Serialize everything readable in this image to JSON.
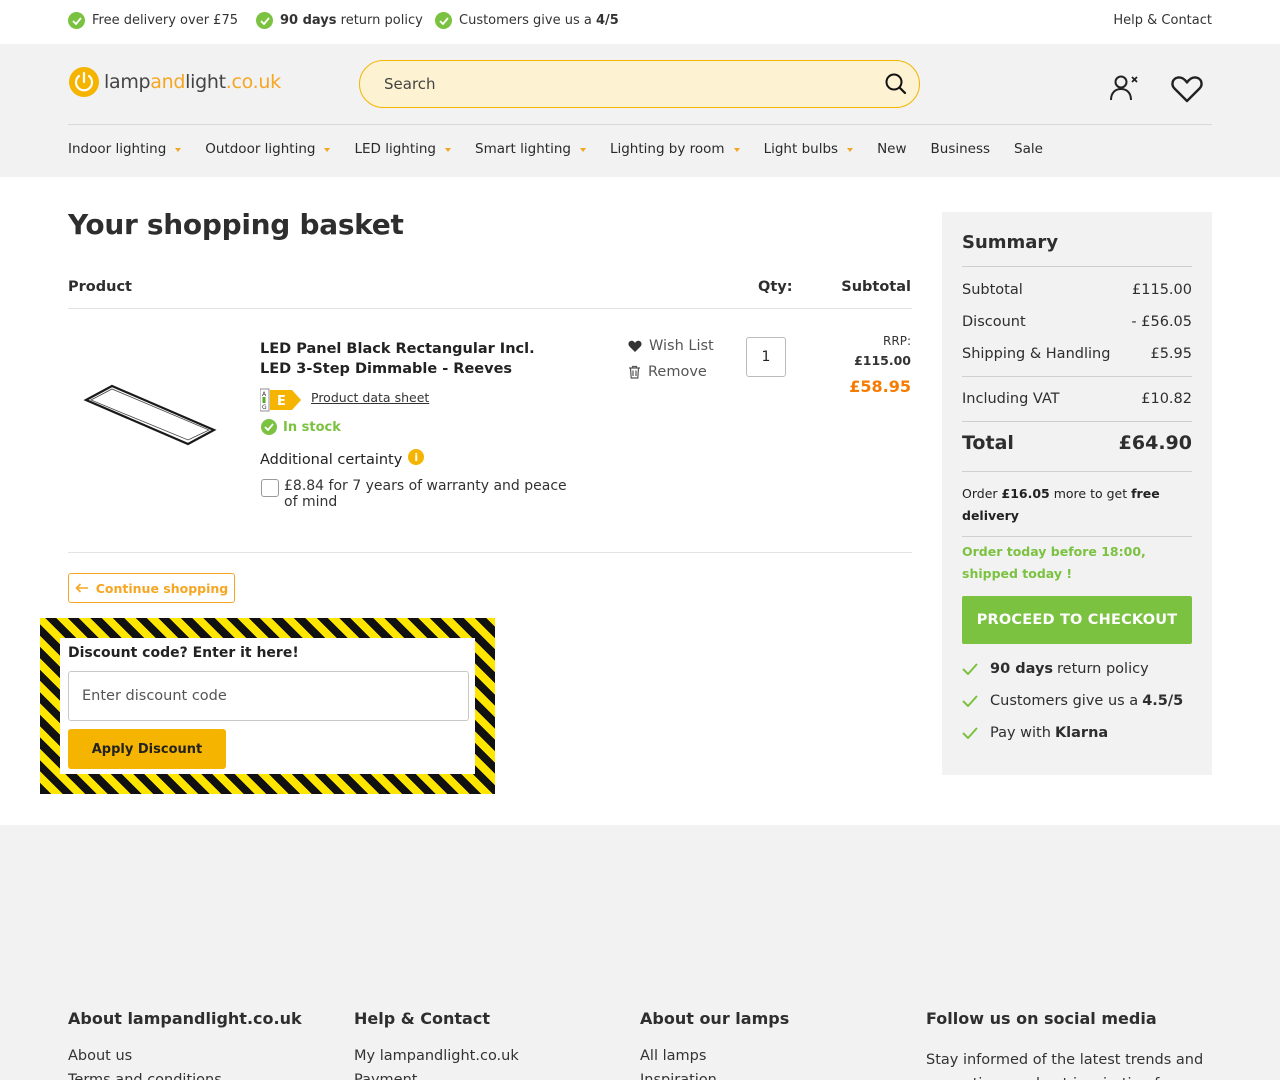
{
  "usp": {
    "delivery": "Free delivery over £75",
    "returns_bold": "90 days",
    "returns_rest": " return policy",
    "rating_text": "Customers give us a ",
    "rating_value": "4/5",
    "help": "Help & Contact"
  },
  "logo": {
    "part1": "lamp",
    "part2": "and",
    "part3": "light",
    "part4": ".co.uk"
  },
  "search": {
    "placeholder": "Search"
  },
  "nav": [
    {
      "label": "Indoor lighting",
      "dropdown": true
    },
    {
      "label": "Outdoor lighting",
      "dropdown": true
    },
    {
      "label": "LED lighting",
      "dropdown": true
    },
    {
      "label": "Smart lighting",
      "dropdown": true
    },
    {
      "label": "Lighting by room",
      "dropdown": true
    },
    {
      "label": "Light bulbs",
      "dropdown": true
    },
    {
      "label": "New",
      "dropdown": false
    },
    {
      "label": "Business",
      "dropdown": false
    },
    {
      "label": "Sale",
      "dropdown": false
    }
  ],
  "basket": {
    "title": "Your shopping basket",
    "col_product": "Product",
    "col_qty": "Qty:",
    "col_subtotal": "Subtotal",
    "item": {
      "name": "LED Panel Black Rectangular Incl. LED 3-Step Dimmable - Reeves",
      "energy_class": "E",
      "datasheet": "Product data sheet",
      "stock": "In stock",
      "additional": "Additional certainty",
      "warranty": "£8.84 for 7 years of warranty and peace of mind",
      "wishlist": "Wish List",
      "remove": "Remove",
      "qty": "1",
      "rrp_label": "RRP:",
      "rrp": "£115.00",
      "price": "£58.95"
    },
    "continue": "Continue shopping"
  },
  "discount": {
    "label": "Discount code? Enter it here!",
    "placeholder": "Enter discount code",
    "button": "Apply Discount"
  },
  "summary": {
    "title": "Summary",
    "subtotal_label": "Subtotal",
    "subtotal": "£115.00",
    "discount_label": "Discount",
    "discount": "- £56.05",
    "shipping_label": "Shipping & Handling",
    "shipping": "£5.95",
    "vat_label": "Including VAT",
    "vat": "£10.82",
    "total_label": "Total",
    "total": "£64.90",
    "freedel_pre": "Order ",
    "freedel_amount": "£16.05",
    "freedel_mid": " more to get ",
    "freedel_bold": "free delivery",
    "shipped": "Order today before 18:00, shipped today !",
    "checkout": "PROCEED TO CHECKOUT",
    "perk1_bold": "90 days",
    "perk1_rest": "return policy",
    "perk2_text": "Customers give us a",
    "perk2_bold": "4.5/5",
    "perk3_text": "Pay with",
    "perk3_bold": "Klarna"
  },
  "footer": {
    "col1": {
      "title": "About lampandlight.co.uk",
      "link1": "About us",
      "link2": "Terms and conditions"
    },
    "col2": {
      "title": "Help & Contact",
      "link1": "My lampandlight.co.uk",
      "link2": "Payment"
    },
    "col3": {
      "title": "About our lamps",
      "link1": "All lamps",
      "link2": "Inspiration"
    },
    "col4": {
      "title": "Follow us on social media",
      "text": "Stay informed of the latest trends and promotions and get inspiration for your"
    }
  },
  "colors": {
    "accent": "#f5b400",
    "green": "#7cc241",
    "price": "#f57c00"
  }
}
